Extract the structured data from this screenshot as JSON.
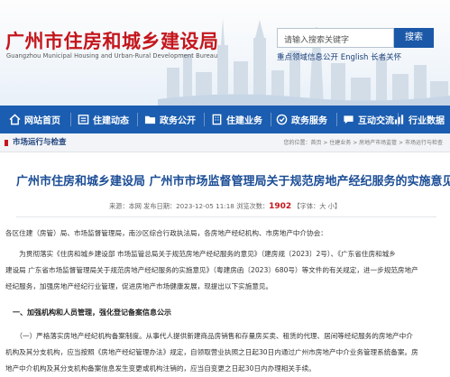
{
  "header": {
    "title": "广州市住房和城乡建设局",
    "subtitle": "Guangzhou Municipal Housing and Urban-Rural Development Bureau",
    "search_placeholder": "请输入搜索关键字",
    "search_button": "搜索",
    "hot_links": "重点领域信息公开  English  长者关怀"
  },
  "nav": {
    "items": [
      {
        "label": "网站首页",
        "icon": "home-icon"
      },
      {
        "label": "住建动态",
        "icon": "news-icon"
      },
      {
        "label": "政务公开",
        "icon": "folder-icon"
      },
      {
        "label": "住建业务",
        "icon": "building-icon"
      },
      {
        "label": "政务服务",
        "icon": "service-icon"
      },
      {
        "label": "互动交流",
        "icon": "chat-icon"
      },
      {
        "label": "行业数据",
        "icon": "chart-icon"
      }
    ]
  },
  "breadcrumb": {
    "section": "市场运行与检查",
    "path": "您的位置：首页 > 住建业务 > 房地产市场监管 > 市场运行与检查"
  },
  "article": {
    "title": "广州市住房和城乡建设局 广州市市场监督管理局关于规范房地产经纪服务的实施意见",
    "meta_prefix": "来源：本网   发布日期：2023-12-05 11:18   浏览次数：",
    "views": "1902",
    "meta_suffix": "  【字体：大  小】",
    "paragraphs": [
      "各区住建（房管）局、市场监督管理局，南沙区综合行政执法局，各房地产经纪机构、市房地产中介协会：",
      [
        "　　为贯彻落实《住房和城乡建设部 市场监管总局关于规范房地产经纪服务的意见》（建房规〔2023〕2号）、《广东省住房和城乡",
        "建设局 广东省市场监督管理局关于规范房地产经纪服务的实施意见》（粤建房函〔2023〕680号）等文件的有关规定，进一步规范房地产",
        "经纪服务，加强房地产经纪行业管理，促进房地产市场健康发展，现提出以下实施意见。"
      ],
      [
        "　　（一）严格落实房地产经纪机构备案制度。从事代人提供新建商品房销售和存量房买卖、租赁的代理、居间等经纪服务的房地产中介",
        "机构及其分支机构，应当按照《房地产经纪管理办法》规定，自领取营业执照之日起30日内通过广州市房地产中介业务管理系统备案。房",
        "地产中介机构及其分支机构备案信息发生变更或机构注销的，应当自变更之日起30日内办理相关手续。"
      ]
    ],
    "section_heading": "一、加强机构和人员管理，强化登记备案信息公示"
  }
}
